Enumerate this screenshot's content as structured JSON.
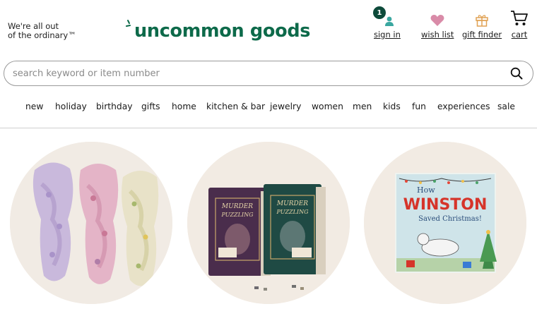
{
  "header": {
    "tagline_line1": "We're all out",
    "tagline_line2": "of the ordinary™",
    "logo_text": "uncommon goods",
    "brand_color": "#0d6a4a"
  },
  "utility_nav": {
    "sign_in": {
      "label": "sign in",
      "badge": "1",
      "icon": "person-icon"
    },
    "wish_list": {
      "label": "wish list",
      "icon": "heart-icon"
    },
    "gift_finder": {
      "label": "gift finder",
      "icon": "gift-icon"
    },
    "cart": {
      "label": "cart",
      "icon": "cart-icon"
    }
  },
  "search": {
    "placeholder": "search keyword or item number",
    "value": "",
    "icon": "search-icon"
  },
  "nav": {
    "items": [
      "new",
      "holiday",
      "birthday",
      "gifts",
      "home",
      "kitchen & bar",
      "jewelry",
      "women",
      "men",
      "kids",
      "fun",
      "experiences",
      "sale"
    ]
  },
  "featured": {
    "book_cover": {
      "title_line1": "How",
      "title_line2": "WINSTON",
      "title_line3": "Saved Christmas!"
    },
    "puzzle_box": {
      "title_line1": "MURDER",
      "title_line2": "PUZZLING"
    }
  }
}
